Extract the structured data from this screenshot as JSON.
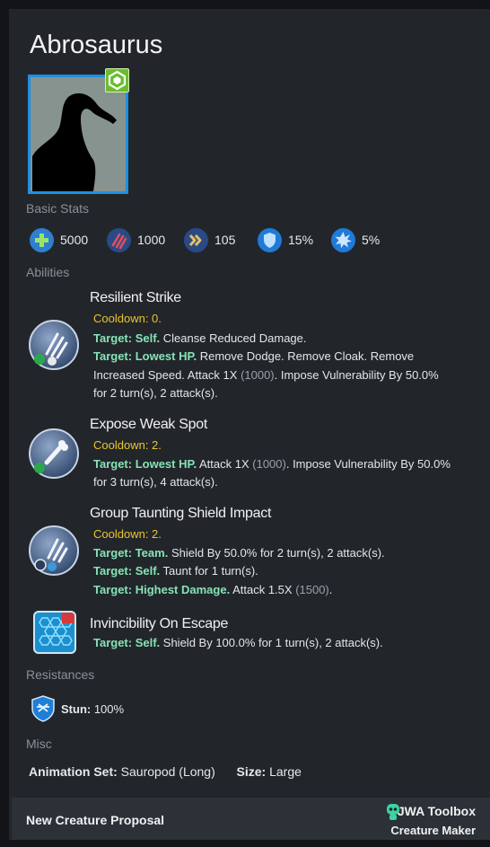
{
  "creature": {
    "name": "Abrosaurus"
  },
  "sections": {
    "basic_stats": "Basic Stats",
    "abilities": "Abilities",
    "resistances": "Resistances",
    "misc": "Misc"
  },
  "stats": [
    {
      "icon": "health-cross-icon",
      "value": "5000",
      "color": "#2f7fd0"
    },
    {
      "icon": "damage-claw-icon",
      "value": "1000",
      "color": "#2a4a86"
    },
    {
      "icon": "speed-chevron-icon",
      "value": "105",
      "color": "#2a4a86"
    },
    {
      "icon": "armor-shield-icon",
      "value": "15%",
      "color": "#1f7ad8"
    },
    {
      "icon": "critical-burst-icon",
      "value": "5%",
      "color": "#1f7ad8"
    }
  ],
  "abilities": [
    {
      "name": "Resilient Strike",
      "cooldown": "Cooldown: 0.",
      "lines": [
        {
          "target": "Target: Self.",
          "text": " Cleanse Reduced Damage."
        },
        {
          "target": "Target: Lowest HP.",
          "text": " Remove Dodge. Remove Cloak. Remove"
        },
        {
          "target": "",
          "text": "Increased Speed. Attack 1X ",
          "num": "(1000)",
          "after": ". Impose Vulnerability By 50.0%"
        },
        {
          "target": "",
          "text": "for 2 turn(s), 2 attack(s)."
        }
      ]
    },
    {
      "name": "Expose Weak Spot",
      "cooldown": "Cooldown: 2.",
      "lines": [
        {
          "target": "Target: Lowest HP.",
          "text": " Attack 1X ",
          "num": "(1000)",
          "after": ". Impose Vulnerability By 50.0%"
        },
        {
          "target": "",
          "text": "for 3 turn(s), 4 attack(s)."
        }
      ]
    },
    {
      "name": "Group Taunting Shield Impact",
      "cooldown": "Cooldown: 2.",
      "lines": [
        {
          "target": "Target: Team.",
          "text": " Shield By 50.0% for 2 turn(s), 2 attack(s)."
        },
        {
          "target": "Target: Self.",
          "text": " Taunt for 1 turn(s)."
        },
        {
          "target": "Target: Highest Damage.",
          "text": " Attack 1.5X ",
          "num": "(1500)",
          "after": "."
        }
      ]
    },
    {
      "name": "Invincibility On Escape",
      "lines": [
        {
          "target": "Target: Self.",
          "text": " Shield By 100.0% for 1 turn(s), 2 attack(s)."
        }
      ]
    }
  ],
  "resistances": [
    {
      "label": "Stun:",
      "value": " 100%"
    }
  ],
  "misc": {
    "animation_label": "Animation Set:",
    "animation_value": " Sauropod (Long)",
    "size_label": "Size:",
    "size_value": " Large"
  },
  "footer": {
    "proposal": "New Creature Proposal",
    "brand": "JWA Toolbox",
    "sub": "Creature Maker"
  }
}
